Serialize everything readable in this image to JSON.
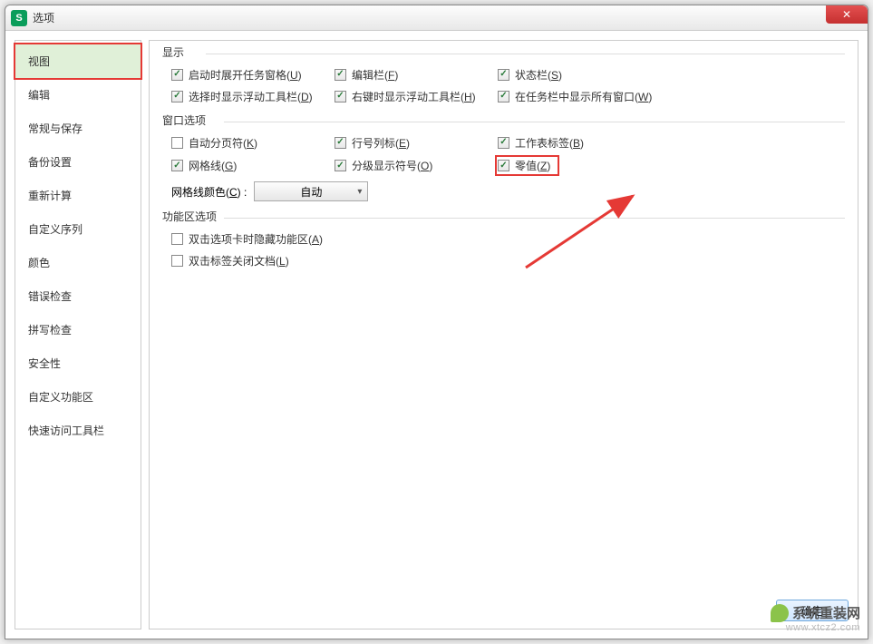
{
  "window": {
    "title": "选项",
    "app_icon_letter": "S"
  },
  "sidebar": {
    "items": [
      {
        "label": "视图",
        "selected": true
      },
      {
        "label": "编辑"
      },
      {
        "label": "常规与保存"
      },
      {
        "label": "备份设置"
      },
      {
        "label": "重新计算"
      },
      {
        "label": "自定义序列"
      },
      {
        "label": "颜色"
      },
      {
        "label": "错误检查"
      },
      {
        "label": "拼写检查"
      },
      {
        "label": "安全性"
      },
      {
        "label": "自定义功能区"
      },
      {
        "label": "快速访问工具栏"
      }
    ]
  },
  "groups": {
    "display": {
      "title": "显示",
      "opts": {
        "startup_taskpane": {
          "label": "启动时展开任务窗格(",
          "key": "U",
          "suffix": ")",
          "checked": true
        },
        "formula_bar": {
          "label": "编辑栏(",
          "key": "F",
          "suffix": ")",
          "checked": true
        },
        "status_bar": {
          "label": "状态栏(",
          "key": "S",
          "suffix": ")",
          "checked": true
        },
        "float_toolbar_select": {
          "label": "选择时显示浮动工具栏(",
          "key": "D",
          "suffix": ")",
          "checked": true
        },
        "float_toolbar_right": {
          "label": "右键时显示浮动工具栏(",
          "key": "H",
          "suffix": ")",
          "checked": true
        },
        "taskbar_windows": {
          "label": "在任务栏中显示所有窗口(",
          "key": "W",
          "suffix": ")",
          "checked": true
        }
      }
    },
    "window_opts": {
      "title": "窗口选项",
      "opts": {
        "page_breaks": {
          "label": "自动分页符(",
          "key": "K",
          "suffix": ")",
          "checked": false
        },
        "row_col_headers": {
          "label": "行号列标(",
          "key": "E",
          "suffix": ")",
          "checked": true
        },
        "sheet_tabs": {
          "label": "工作表标签(",
          "key": "B",
          "suffix": ")",
          "checked": true
        },
        "gridlines": {
          "label": "网格线(",
          "key": "G",
          "suffix": ")",
          "checked": true
        },
        "outline_symbols": {
          "label": "分级显示符号(",
          "key": "O",
          "suffix": ")",
          "checked": true
        },
        "zero_values": {
          "label": "零值(",
          "key": "Z",
          "suffix": ")",
          "checked": true
        }
      },
      "grid_color_label": "网格线颜色(",
      "grid_color_key": "C",
      "grid_color_suffix": ") :",
      "grid_color_value": "自动"
    },
    "ribbon_opts": {
      "title": "功能区选项",
      "opts": {
        "dblclick_hide_ribbon": {
          "label": "双击选项卡时隐藏功能区(",
          "key": "A",
          "suffix": ")",
          "checked": false
        },
        "dblclick_close_doc": {
          "label": "双击标签关闭文档(",
          "key": "L",
          "suffix": ")",
          "checked": false
        }
      }
    }
  },
  "footer": {
    "ok": "确定"
  },
  "watermark": {
    "text": "系统重装网",
    "url": "www.xtcz2.com"
  }
}
